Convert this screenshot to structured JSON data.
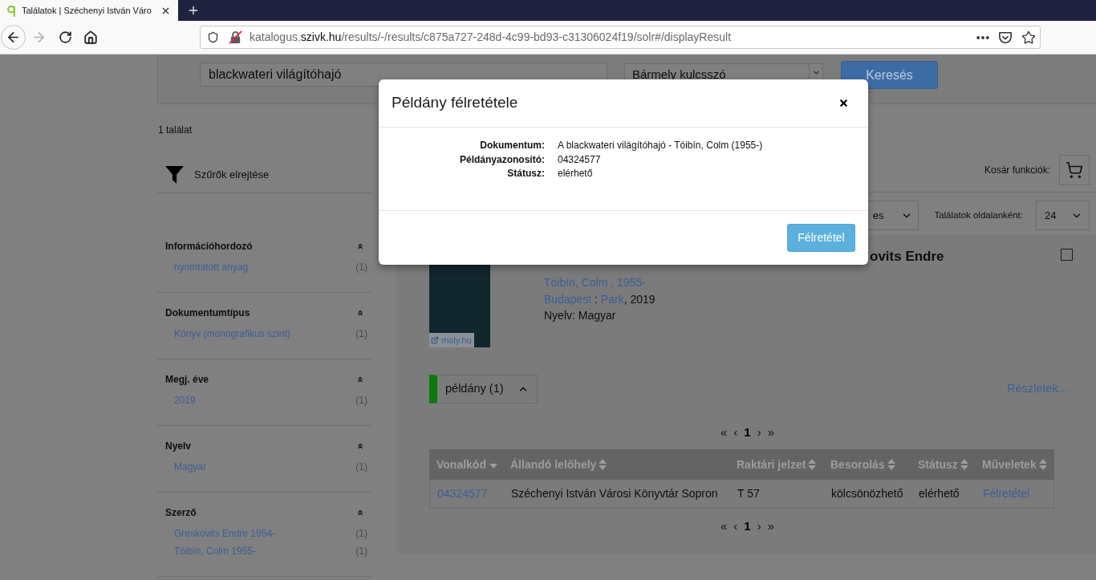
{
  "browser": {
    "tab": {
      "title": "Találatok | Széchenyi István Váro",
      "selected": true
    },
    "nav": {
      "back_disabled": false,
      "forward_disabled": true
    },
    "url": {
      "subdomain": "katalogus.",
      "domain": "szivk.hu",
      "path": "/results/-/results/c875a727-248d-4c99-bd93-c31306024f19/solr#/displayResult"
    }
  },
  "search": {
    "query": "blackwateri világítóhajó",
    "field": "Bármely kulcsszó",
    "button": "Keresés"
  },
  "sidebar": {
    "result_count": "1 találat",
    "filters_toggle": "Szűrők elrejtése",
    "facets": [
      {
        "title": "Információhordozó",
        "expanded": true,
        "items": [
          {
            "label": "nyomtatott anyag",
            "count": "(1)"
          }
        ]
      },
      {
        "title": "Dokumentumtípus",
        "expanded": true,
        "items": [
          {
            "label": "Könyv (monografikus szint)",
            "count": "(1)"
          }
        ]
      },
      {
        "title": "Megj. éve",
        "expanded": true,
        "items": [
          {
            "label": "2019",
            "count": "(1)"
          }
        ]
      },
      {
        "title": "Nyelv",
        "expanded": true,
        "items": [
          {
            "label": "Magyar",
            "count": "(1)"
          }
        ]
      },
      {
        "title": "Szerző",
        "expanded": true,
        "items": [
          {
            "label": "Greskovits Endre 1954-",
            "count": "(1)"
          },
          {
            "label": "Tóibín, Colm 1955-",
            "count": "(1)"
          }
        ]
      }
    ]
  },
  "toolbar": {
    "cart_label": "Kosár funkciók:",
    "sort_value": "es",
    "per_page_label": "Találatok oldalanként:",
    "per_page_value": "24"
  },
  "result": {
    "title": "ovits Endre",
    "selected": false,
    "cover_link": "moly.hu",
    "author": "Tóibín, Colm , 1955-",
    "imprint": [
      {
        "kind": "link",
        "text": "Budapest"
      },
      {
        "kind": "text",
        "text": " : "
      },
      {
        "kind": "link",
        "text": "Park"
      },
      {
        "kind": "text",
        "text": ", 2019"
      }
    ],
    "language": "Nyelv: Magyar"
  },
  "holdings": {
    "toggle": {
      "label": "példány (1)",
      "expanded": true
    },
    "details_link": "Részletek...",
    "pagination_top": [
      {
        "label": "«",
        "selected": false
      },
      {
        "label": "‹",
        "selected": false
      },
      {
        "label": "1",
        "selected": true
      },
      {
        "label": "›",
        "selected": false
      },
      {
        "label": "»",
        "selected": false
      }
    ],
    "table": {
      "columns": [
        {
          "label": "Vonalkód",
          "sorted": true
        },
        {
          "label": "Állandó lelőhely",
          "sorted": false
        },
        {
          "label": "Raktári jelzet",
          "sorted": false
        },
        {
          "label": "Besorolás",
          "sorted": false
        },
        {
          "label": "Státusz",
          "sorted": false
        },
        {
          "label": "Műveletek",
          "sorted": false
        }
      ],
      "rows": [
        {
          "cells": [
            {
              "kind": "link",
              "text": "04324577"
            },
            {
              "kind": "text",
              "text": "Széchenyi István Városi Könyvtár Sopron"
            },
            {
              "kind": "text",
              "text": "T 57"
            },
            {
              "kind": "text",
              "text": "kölcsönözhető"
            },
            {
              "kind": "text",
              "text": "elérhető"
            },
            {
              "kind": "link",
              "text": "Félretétel"
            }
          ]
        }
      ]
    },
    "pagination_bottom": [
      {
        "label": "«",
        "selected": false
      },
      {
        "label": "‹",
        "selected": false
      },
      {
        "label": "1",
        "selected": true
      },
      {
        "label": "›",
        "selected": false
      },
      {
        "label": "»",
        "selected": false
      }
    ]
  },
  "modal": {
    "title": "Példány félretétele",
    "fields": [
      {
        "label": "Dokumentum:",
        "value": "A blackwateri világítóhajó - Tóibín, Colm (1955-)"
      },
      {
        "label": "Példányazonosító:",
        "value": "04324577"
      },
      {
        "label": "Státusz:",
        "value": "elérhető"
      }
    ],
    "button": "Félretétel"
  }
}
